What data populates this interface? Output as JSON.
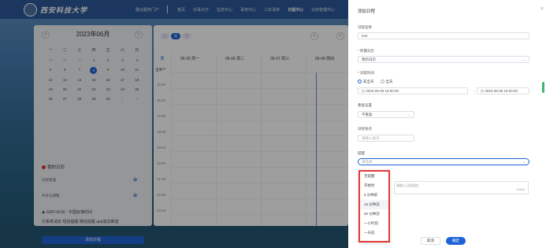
{
  "header": {
    "logo_text": "西安科技大学",
    "nav": [
      "融合服务门户",
      "首页",
      "办事大厅",
      "信息中心",
      "事务中心",
      "三实清单",
      "日程中心",
      "北京管理中心"
    ],
    "active_nav": "日程中心"
  },
  "sidebar": {
    "month_title": "2023年06月",
    "prev": "<",
    "next": ">",
    "weekdays": [
      "一",
      "二",
      "三",
      "四",
      "五",
      "六",
      "日"
    ],
    "days": [
      {
        "d": "29",
        "m": true
      },
      {
        "d": "30",
        "m": true
      },
      {
        "d": "31",
        "m": true
      },
      {
        "d": "1"
      },
      {
        "d": "2"
      },
      {
        "d": "3"
      },
      {
        "d": "4"
      },
      {
        "d": "5"
      },
      {
        "d": "6"
      },
      {
        "d": "7"
      },
      {
        "d": "8",
        "s": true
      },
      {
        "d": "9"
      },
      {
        "d": "10"
      },
      {
        "d": "11"
      },
      {
        "d": "12"
      },
      {
        "d": "13"
      },
      {
        "d": "14"
      },
      {
        "d": "15"
      },
      {
        "d": "16"
      },
      {
        "d": "17"
      },
      {
        "d": "18"
      },
      {
        "d": "19"
      },
      {
        "d": "20"
      },
      {
        "d": "21"
      },
      {
        "d": "22"
      },
      {
        "d": "23"
      },
      {
        "d": "24"
      },
      {
        "d": "25"
      },
      {
        "d": "26"
      },
      {
        "d": "27"
      },
      {
        "d": "28"
      },
      {
        "d": "29"
      },
      {
        "d": "30"
      },
      {
        "d": "1",
        "m": true
      },
      {
        "d": "2",
        "m": true
      }
    ],
    "my_schedule": "我的日历",
    "schedule_item": "日程管理",
    "shared_item": "共享与调整",
    "timezone": "GMT+8:00 · 中国标准时间",
    "remind_text": "引系统消息 短信提醒 微信提醒 app消息推送",
    "add_button": "添加日程"
  },
  "calendar": {
    "view_tabs": [
      "日",
      "周",
      "月"
    ],
    "active_tab": "周",
    "week_label": "周",
    "columns": [
      "06-05 周一",
      "06-06 周二",
      "06-07 周三",
      "06-08 周四"
    ],
    "allday": "全天",
    "times": [
      "14:00",
      "15:00",
      "16:00",
      "17:00",
      "18:00",
      "19:00",
      "20:00",
      "21:00",
      "22:00",
      "23:00"
    ]
  },
  "drawer": {
    "title": "添加日程",
    "close": "×",
    "name_label": "日程名称",
    "name_value": "test",
    "calendar_label": "所属日历",
    "calendar_value": "我的日历",
    "time_label": "日程时间",
    "radio_not_allday": "非全天",
    "radio_allday": "全天",
    "start_value": "2023-06-08 15:00:00",
    "end_value": "2023-06-08 16:00:00",
    "repeat_label": "重复设置",
    "repeat_value": "不重复",
    "location_label": "日程地点",
    "location_placeholder": "请输入地点",
    "remind_label": "提醒",
    "remind_placeholder": "请选择",
    "desc_placeholder": "请输入日程描述",
    "desc_count": "0/500",
    "remind_options": [
      "无提醒",
      "开始时",
      "5 分钟前",
      "15 分钟前",
      "30 分钟前",
      "一小时前",
      "一天前"
    ],
    "cancel": "取消",
    "confirm": "确定"
  },
  "colors": {
    "accent": "#1f64d6",
    "highlight_border": "#e23a3a"
  }
}
